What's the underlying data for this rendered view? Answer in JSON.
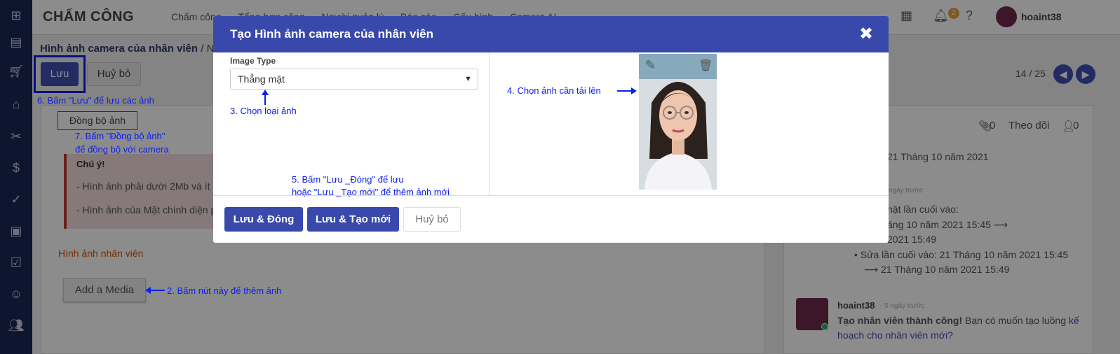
{
  "navbar": {
    "app_title": "CHẤM CÔNG",
    "menu": [
      "Chấm công",
      "Tổng hợp công",
      "Người quản lý",
      "Báo cáo",
      "Cấu hình",
      "Camera AI"
    ],
    "notification_count": "2",
    "username": "hoaint38"
  },
  "breadcrumb": {
    "parent": "Hình ảnh camera của nhân viên",
    "separator": "/",
    "current": "Ngu"
  },
  "control_panel": {
    "save_label": "Lưu",
    "cancel_label": "Huỷ bỏ",
    "pager": "14 / 25"
  },
  "form": {
    "sync_label": "Đồng bộ ảnh",
    "alert_title": "Chú ý!",
    "alert_line1": "- Hình ảnh phải dưới 2Mb và ít nh",
    "alert_line2": "- Hình ảnh của Mặt chính diện ph",
    "section_title": "Hình ảnh nhân viên",
    "add_media_label": "Add a Media"
  },
  "chatter": {
    "attachments": "0",
    "follow_label": "Theo dõi",
    "followers": "0",
    "date_divider": "21 Tháng 10 năm 2021",
    "ago1": "ngày trước",
    "change_line1": "hật lần cuối vào:",
    "change_line2": "áng 10 năm 2021 15:45 ⟶",
    "change_line3": "2021 15:49",
    "change_line4": "Sửa lần cuối vào: 21 Tháng 10 năm 2021 15:45",
    "change_line5": "⟶ 21 Tháng 10 năm 2021 15:49",
    "msg_user": "hoaint38",
    "msg_ago": "- 5 ngày trước",
    "msg_bold": "Tạo nhân viên thành công!",
    "msg_text": " Bạn có muốn tạo luồng ",
    "msg_link1": "kế",
    "msg_link2": "hoạch cho nhân viên mới?"
  },
  "modal": {
    "title": "Tạo Hình ảnh camera của nhân viên",
    "field_label": "Image Type",
    "select_value": "Thẳng mặt",
    "btn_save_close": "Lưu & Đóng",
    "btn_save_new": "Lưu & Tạo mới",
    "btn_cancel": "Huỷ bỏ"
  },
  "annotations": {
    "a2": "2. Bấm nút này để thêm ảnh",
    "a3": "3. Chọn loại ảnh",
    "a4": "4. Chọn ảnh cần tải lên",
    "a5_line1": "5. Bấm \"Lưu _Đóng\" để lưu",
    "a5_line2": "hoặc \"Lưu _Tạo mới\" để thêm ảnh mới",
    "a6": "6. Bấm \"Lưu\" để lưu các ảnh",
    "a7_line1": "7. Bấm \"Đồng bộ ảnh\"",
    "a7_line2": "để đồng bộ với camera"
  },
  "colors": {
    "rail": "#1a2757",
    "primary": "#3949ab",
    "annotation": "#0a1ef0"
  }
}
